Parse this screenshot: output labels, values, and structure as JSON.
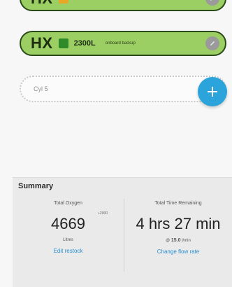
{
  "cylinders": [
    {
      "code": "HX",
      "swatch_color": "#e9a727",
      "volume": "",
      "note": ""
    },
    {
      "code": "HX",
      "swatch_color": "#2f8a2a",
      "volume": "2300L",
      "note": "onboard backup"
    }
  ],
  "placeholder": {
    "label": "Cyl 5"
  },
  "summary": {
    "title": "Summary",
    "oxygen": {
      "label": "Total Oxygen",
      "delta": "+2000",
      "value": "4669",
      "unit": "Litres",
      "link": "Edit restock"
    },
    "time": {
      "label": "Total Time Remaining",
      "value": "4 hrs 27 min",
      "rate_prefix": "@",
      "rate_value": "15.0",
      "rate_unit": "l/min",
      "link": "Change flow rate"
    }
  },
  "colors": {
    "pill_bg": "#9bcf63",
    "pill_border": "#2b4a1a",
    "fab": "#2aa4db",
    "link": "#2a8fd0"
  },
  "icons": {
    "edit": "pencil-icon",
    "add": "plus-icon"
  }
}
